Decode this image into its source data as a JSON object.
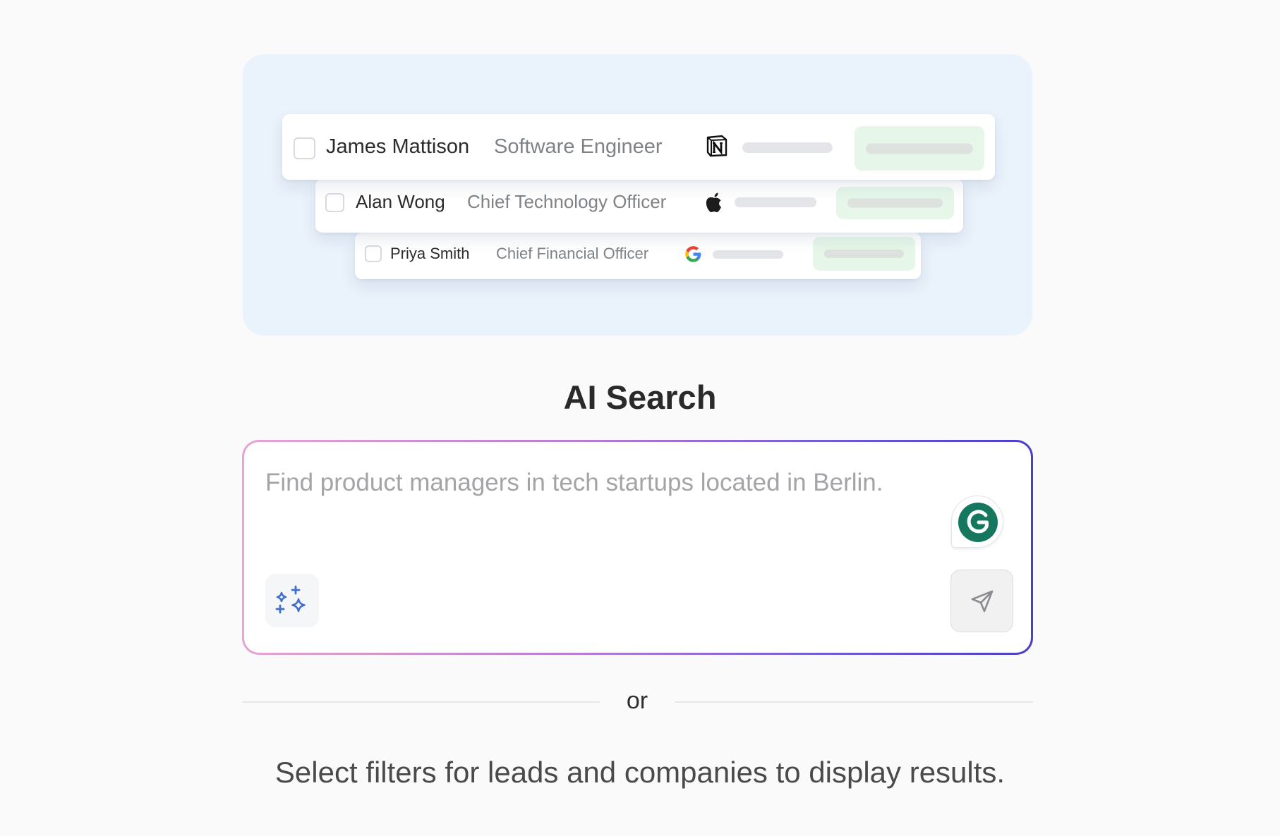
{
  "preview": {
    "cards": [
      {
        "name": "James Mattison",
        "role": "Software Engineer",
        "company_icon": "notion-icon"
      },
      {
        "name": "Alan Wong",
        "role": "Chief Technology Officer",
        "company_icon": "apple-icon"
      },
      {
        "name": "Priya Smith",
        "role": "Chief Financial Officer",
        "company_icon": "google-icon"
      }
    ]
  },
  "title": "AI Search",
  "search": {
    "placeholder": "Find product managers in tech startups located in Berlin.",
    "ai_button_icon": "sparkles-icon",
    "send_button_icon": "send-icon",
    "extension_icon": "grammarly-icon"
  },
  "divider": {
    "label": "or"
  },
  "hint": "Select filters for leads and companies to display results.",
  "colors": {
    "preview_bg": "#eaf2fb",
    "pill_green": "#e6f7ea",
    "accent_gradient_start": "#e6a5d4",
    "accent_gradient_end": "#4b3fc7",
    "sparkle_blue": "#3f6fd1",
    "grammarly_green": "#15775e"
  }
}
